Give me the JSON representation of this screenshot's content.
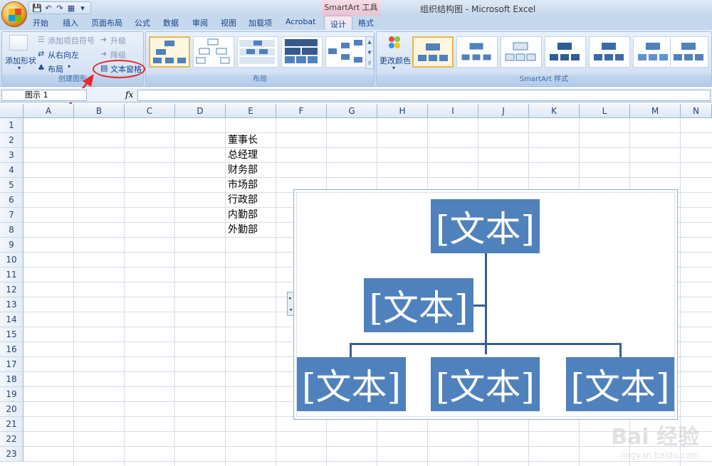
{
  "window": {
    "title": "组织结构图 - Microsoft Excel",
    "context_tool": "SmartArt 工具"
  },
  "quick_access": [
    "💾",
    "↶",
    "↷",
    "▦",
    "▾"
  ],
  "tabs": [
    "开始",
    "插入",
    "页面布局",
    "公式",
    "数据",
    "审阅",
    "视图",
    "加载项",
    "Acrobat",
    "设计",
    "格式"
  ],
  "active_tab": "设计",
  "ribbon": {
    "create_graphic": {
      "label": "创建图形",
      "add_shape": "添加形状",
      "add_bullet": "添加项目符号",
      "right_to_left": "从右向左",
      "layout": "布局",
      "promote": "升级",
      "demote": "降级",
      "text_pane": "文本窗格"
    },
    "layouts": {
      "label": "布局"
    },
    "styles": {
      "label": "SmartArt 样式",
      "change_colors": "更改颜色"
    }
  },
  "formula_bar": {
    "name_box": "图示 1",
    "fx": "fx",
    "value": ""
  },
  "columns": [
    "A",
    "B",
    "C",
    "D",
    "E",
    "F",
    "G",
    "H",
    "I",
    "J",
    "K",
    "L",
    "M",
    "N"
  ],
  "rows": [
    "1",
    "2",
    "3",
    "4",
    "5",
    "6",
    "7",
    "8",
    "9",
    "10",
    "11",
    "12",
    "13",
    "14",
    "15",
    "16",
    "17",
    "18",
    "19",
    "20",
    "21",
    "22",
    "23"
  ],
  "cells": {
    "E2": "董事长",
    "E3": "总经理",
    "E4": "财务部",
    "E5": "市场部",
    "E6": "行政部",
    "E7": "内勤部",
    "E8": "外勤部"
  },
  "smartart": {
    "node_text": "[文本]",
    "box_color": "#4f81bd"
  },
  "accent": {
    "highlight": "#e8262a",
    "selected_gallery": "#f0b54c"
  },
  "watermark": {
    "brand": "Bai 经验",
    "url": "jingyan.baidu.com"
  }
}
